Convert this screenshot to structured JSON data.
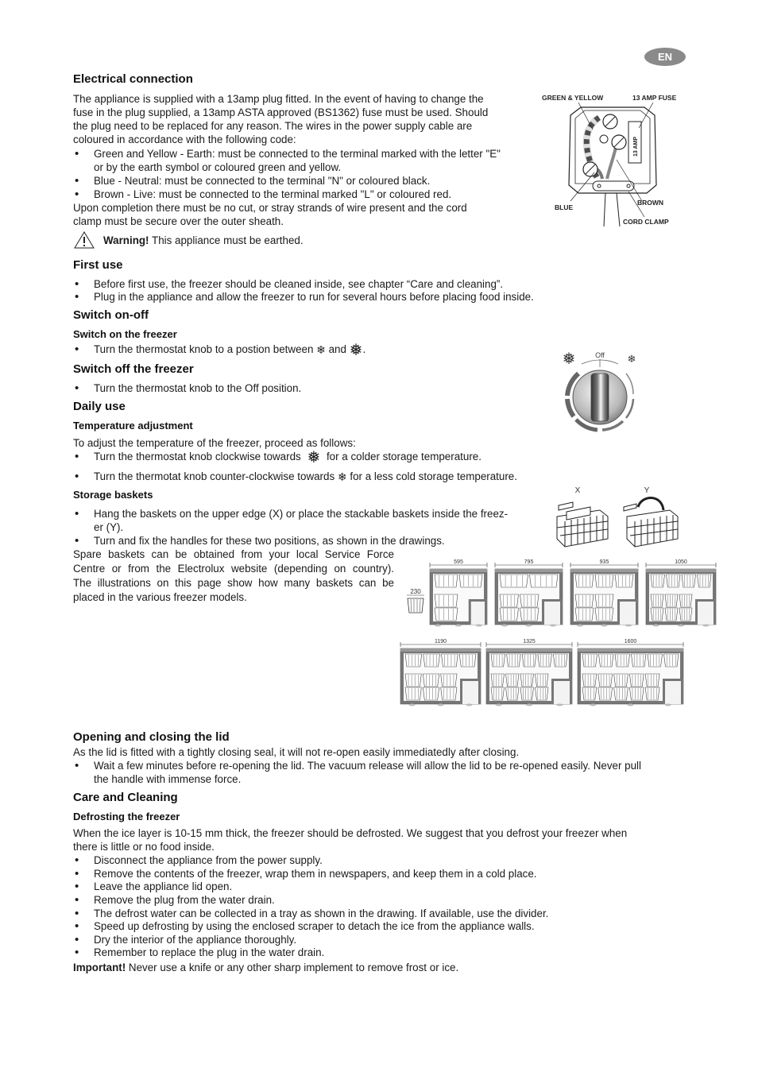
{
  "badge": {
    "language": "EN"
  },
  "electrical": {
    "heading": "Electrical connection",
    "intro_lines": [
      "The appliance is supplied with a 13amp plug fitted. In the event of having to change the",
      "fuse in the plug supplied, a 13amp ASTA approved (BS1362) fuse must be used. Should",
      "the plug need to be replaced for any reason. The wires in the power supply cable are",
      "coloured in accordance with the following code:"
    ],
    "bullets": [
      {
        "line1": "Green and Yellow - Earth: must be connected to the terminal marked with the letter \"E\"",
        "line2": "or by the earth symbol or coloured green and yellow."
      },
      {
        "line1": "Blue - Neutral: must be connected to the terminal \"N\" or coloured black."
      },
      {
        "line1": "Brown - Live: must be connected to the terminal marked \"L\" or coloured red."
      }
    ],
    "completion_lines": [
      "Upon completion there must be no cut, or stray strands of wire present and the cord",
      "clamp must be secure over the outer sheath."
    ],
    "warning_label": "Warning!",
    "warning_text": " This appliance must be earthed.",
    "plug_diagram": {
      "labels": {
        "green_yellow": "GREEN & YELLOW",
        "fuse": "13 AMP FUSE",
        "fuse_body": "13 AMP",
        "blue": "BLUE",
        "brown": "BROWN",
        "cord_clamp": "CORD CLAMP"
      }
    }
  },
  "first_use": {
    "heading": "First use",
    "bullets": [
      "Before first use, the freezer should be cleaned inside, see chapter “Care and cleaning”.",
      "Plug in the appliance and allow the freezer to run for several hours before placing food inside."
    ]
  },
  "switch": {
    "heading": "Switch on-off",
    "on_heading": "Switch on the freezer",
    "on_bullet_prefix": "Turn the thermostat knob to a postion between ",
    "on_bullet_mid": " and ",
    "on_bullet_suffix": ".",
    "off_heading": "Switch off the freezer",
    "off_bullet": "Turn the thermostat knob to the Off position.",
    "knob": {
      "off_label": "Off"
    }
  },
  "daily": {
    "heading": "Daily use",
    "temp_heading": "Temperature adjustment",
    "temp_intro": "To adjust the temperature of the freezer, proceed as follows:",
    "temp_b1_prefix": "Turn the thermostat knob clockwise towards ",
    "temp_b1_suffix": " for a colder storage temperature.",
    "temp_b2_prefix": "Turn the thermotat knob counter-clockwise towards ",
    "temp_b2_suffix": " for a less cold storage temperature.",
    "baskets_heading": "Storage baskets",
    "baskets_b1_line1": "Hang the baskets on the upper edge (X) or place the stackable baskets inside the freez-",
    "baskets_b1_line2": "er (Y).",
    "baskets_b2": "Turn and fix the handles for these two positions, as shown in the drawings.",
    "spare_lines": [
      "Spare baskets can be obtained from your local Service Force",
      "Centre or from the Electrolux website (depending on country).",
      "The illustrations on this page show how many baskets can be",
      "placed in the various freezer models."
    ],
    "basket_positions": {
      "x_label": "X",
      "y_label": "Y"
    },
    "basket_width_label": "230",
    "models": [
      {
        "width": "595",
        "top_baskets": 2,
        "bottom_baskets": 1
      },
      {
        "width": "795",
        "top_baskets": 2,
        "bottom_baskets": 2
      },
      {
        "width": "935",
        "top_baskets": 3,
        "bottom_baskets": 2
      },
      {
        "width": "1050",
        "top_baskets": 4,
        "bottom_baskets": 3
      },
      {
        "width": "1190",
        "top_baskets": 4,
        "bottom_baskets": 3
      },
      {
        "width": "1325",
        "top_baskets": 5,
        "bottom_baskets": 4
      },
      {
        "width": "1600",
        "top_baskets": 6,
        "bottom_baskets": 5
      }
    ]
  },
  "lid": {
    "heading": "Opening and closing the lid",
    "intro": "As the lid is fitted with a tightly closing seal, it will not re-open easily immediatedly after closing.",
    "bullet_line1": "Wait a few minutes before re-opening the lid. The vacuum release will allow the lid to be re-opened easily. Never pull",
    "bullet_line2": "the handle with immense force."
  },
  "care": {
    "heading": "Care and Cleaning",
    "defrost_heading": "Defrosting the freezer",
    "intro_line1": "When the ice layer is 10-15 mm thick, the freezer should be defrosted. We suggest that you defrost your freezer when",
    "intro_line2": "there is little or no food inside.",
    "bullets": [
      "Disconnect the appliance from the power supply.",
      "Remove the contents of the freezer, wrap them in newspapers, and keep them in a cold place.",
      "Leave the appliance lid open.",
      "Remove the plug from the water drain.",
      "The defrost water can be collected in a tray as shown in the drawing. If available, use the divider.",
      "Speed up defrosting by using the enclosed scraper to detach the ice from the appliance walls.",
      "Dry the interior of the appliance thoroughly.",
      "Remember to replace the plug in the water drain."
    ],
    "important_label": "Important!",
    "important_text": " Never use a knife or any other sharp implement to remove frost or ice."
  }
}
